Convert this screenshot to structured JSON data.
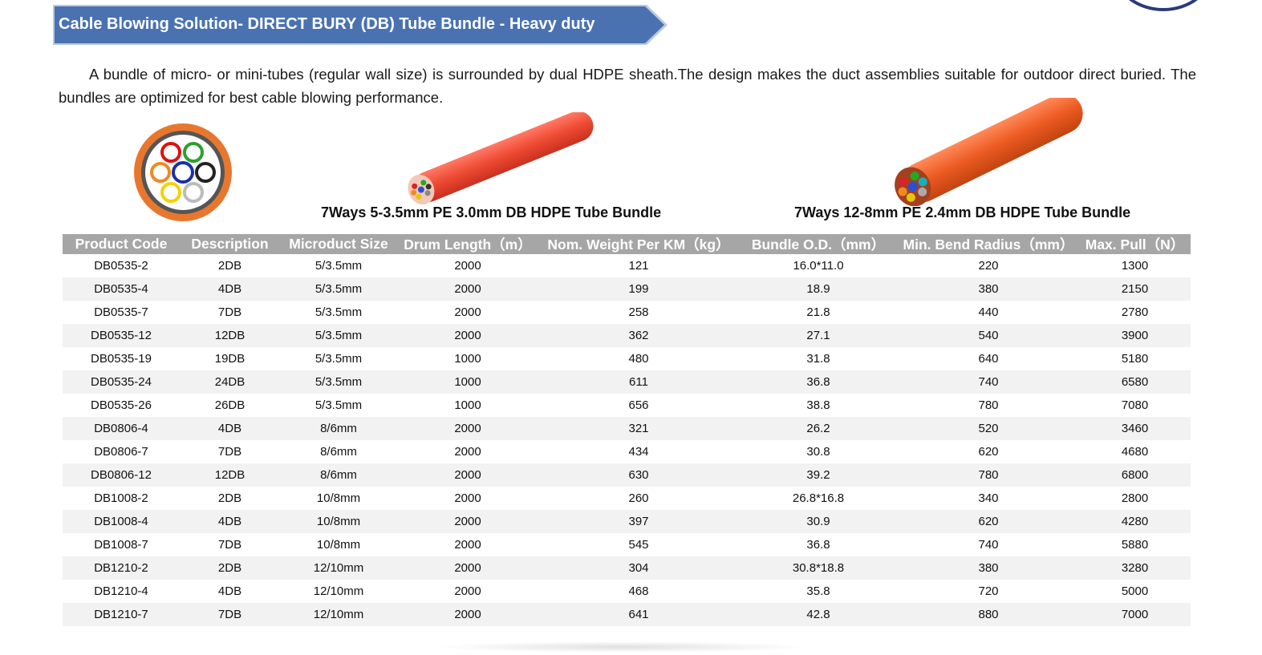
{
  "header": {
    "title": "Cable Blowing Solution- DIRECT BURY (DB) Tube Bundle - Heavy duty",
    "banner_color": "#4a72b0"
  },
  "intro": "A bundle of micro- or mini-tubes (regular wall size) is surrounded by dual HDPE sheath.The design makes the duct assemblies suitable for outdoor direct buried. The bundles are optimized for best cable blowing performance.",
  "images": {
    "cross_section": "tube-bundle-cross-section",
    "product_1": {
      "caption": "7Ways 5-3.5mm PE 3.0mm DB HDPE Tube Bundle"
    },
    "product_2": {
      "caption": "7Ways 12-8mm PE 2.4mm DB HDPE Tube Bundle"
    }
  },
  "table": {
    "headers": [
      "Product Code",
      "Description",
      "Microduct Size",
      "Drum Length（m）",
      "Nom. Weight Per KM（kg）",
      "Bundle O.D.（mm）",
      "Min. Bend Radius（mm）",
      "Max. Pull（N）"
    ],
    "rows": [
      [
        "DB0535-2",
        "2DB",
        "5/3.5mm",
        "2000",
        "121",
        "16.0*11.0",
        "220",
        "1300"
      ],
      [
        "DB0535-4",
        "4DB",
        "5/3.5mm",
        "2000",
        "199",
        "18.9",
        "380",
        "2150"
      ],
      [
        "DB0535-7",
        "7DB",
        "5/3.5mm",
        "2000",
        "258",
        "21.8",
        "440",
        "2780"
      ],
      [
        "DB0535-12",
        "12DB",
        "5/3.5mm",
        "2000",
        "362",
        "27.1",
        "540",
        "3900"
      ],
      [
        "DB0535-19",
        "19DB",
        "5/3.5mm",
        "1000",
        "480",
        "31.8",
        "640",
        "5180"
      ],
      [
        "DB0535-24",
        "24DB",
        "5/3.5mm",
        "1000",
        "611",
        "36.8",
        "740",
        "6580"
      ],
      [
        "DB0535-26",
        "26DB",
        "5/3.5mm",
        "1000",
        "656",
        "38.8",
        "780",
        "7080"
      ],
      [
        "DB0806-4",
        "4DB",
        "8/6mm",
        "2000",
        "321",
        "26.2",
        "520",
        "3460"
      ],
      [
        "DB0806-7",
        "7DB",
        "8/6mm",
        "2000",
        "434",
        "30.8",
        "620",
        "4680"
      ],
      [
        "DB0806-12",
        "12DB",
        "8/6mm",
        "2000",
        "630",
        "39.2",
        "780",
        "6800"
      ],
      [
        "DB1008-2",
        "2DB",
        "10/8mm",
        "2000",
        "260",
        "26.8*16.8",
        "340",
        "2800"
      ],
      [
        "DB1008-4",
        "4DB",
        "10/8mm",
        "2000",
        "397",
        "30.9",
        "620",
        "4280"
      ],
      [
        "DB1008-7",
        "7DB",
        "10/8mm",
        "2000",
        "545",
        "36.8",
        "740",
        "5880"
      ],
      [
        "DB1210-2",
        "2DB",
        "12/10mm",
        "2000",
        "304",
        "30.8*18.8",
        "380",
        "3280"
      ],
      [
        "DB1210-4",
        "4DB",
        "12/10mm",
        "2000",
        "468",
        "35.8",
        "720",
        "5000"
      ],
      [
        "DB1210-7",
        "7DB",
        "12/10mm",
        "2000",
        "641",
        "42.8",
        "880",
        "7000"
      ]
    ]
  }
}
